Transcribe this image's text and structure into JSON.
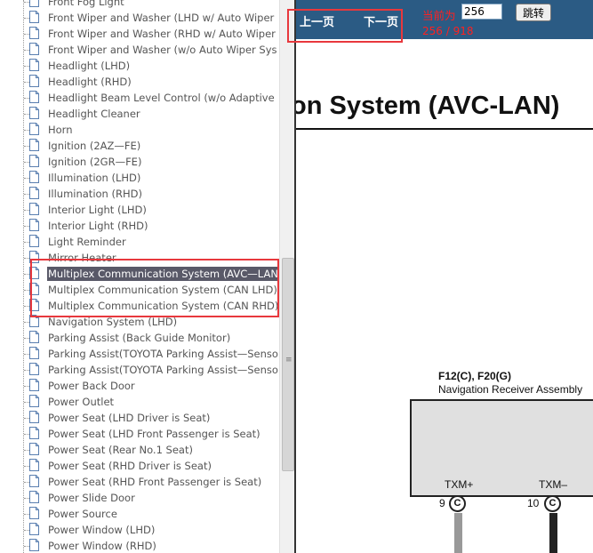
{
  "tree": {
    "items": [
      {
        "label": "Front Fog Light"
      },
      {
        "label": "Front Wiper and Washer (LHD w/ Auto Wiper"
      },
      {
        "label": "Front Wiper and Washer (RHD w/ Auto Wiper"
      },
      {
        "label": "Front Wiper and Washer (w/o Auto Wiper Sys"
      },
      {
        "label": "Headlight (LHD)"
      },
      {
        "label": "Headlight (RHD)"
      },
      {
        "label": "Headlight Beam Level Control (w/o Adaptive"
      },
      {
        "label": "Headlight Cleaner"
      },
      {
        "label": "Horn"
      },
      {
        "label": "Ignition (2AZ—FE)"
      },
      {
        "label": "Ignition (2GR—FE)"
      },
      {
        "label": "Illumination (LHD)"
      },
      {
        "label": "Illumination (RHD)"
      },
      {
        "label": "Interior Light (LHD)"
      },
      {
        "label": "Interior Light (RHD)"
      },
      {
        "label": "Light Reminder"
      },
      {
        "label": "Mirror Heater"
      },
      {
        "label": "Multiplex Communication System (AVC—LAN"
      },
      {
        "label": "Multiplex Communication System (CAN LHD)"
      },
      {
        "label": "Multiplex Communication System (CAN RHD)"
      },
      {
        "label": "Navigation System (LHD)"
      },
      {
        "label": "Parking Assist (Back Guide Monitor)"
      },
      {
        "label": "Parking Assist(TOYOTA Parking Assist—Senso"
      },
      {
        "label": "Parking Assist(TOYOTA Parking Assist—Senso"
      },
      {
        "label": "Power Back Door"
      },
      {
        "label": "Power Outlet"
      },
      {
        "label": "Power Seat (LHD Driver is Seat)"
      },
      {
        "label": "Power Seat (LHD Front Passenger is Seat)"
      },
      {
        "label": "Power Seat (Rear No.1 Seat)"
      },
      {
        "label": "Power Seat (RHD Driver is Seat)"
      },
      {
        "label": "Power Seat (RHD Front Passenger is Seat)"
      },
      {
        "label": "Power Slide Door"
      },
      {
        "label": "Power Source"
      },
      {
        "label": "Power Window (LHD)"
      },
      {
        "label": "Power Window (RHD)"
      }
    ],
    "selected_index": 17
  },
  "toolbar": {
    "prev_label": "上一页",
    "next_label": "下一页",
    "current_label": "当前为",
    "page_value": "256",
    "jump_label": "跳转",
    "page_count": "256 / 918"
  },
  "document": {
    "title": "ion System (AVC-LAN)",
    "connector_code": "F12(C), F20(G)",
    "connector_name": "Navigation Receiver Assembly",
    "pins": [
      {
        "num": "9",
        "label": "TXM+",
        "code": "C"
      },
      {
        "num": "10",
        "label": "TXM–",
        "code": "C"
      }
    ]
  },
  "colors": {
    "toolbar_bg": "#2b5b84",
    "highlight": "#e8383d",
    "selected_bg": "#595968",
    "wire_gray": "#999999",
    "wire_black": "#222222"
  }
}
